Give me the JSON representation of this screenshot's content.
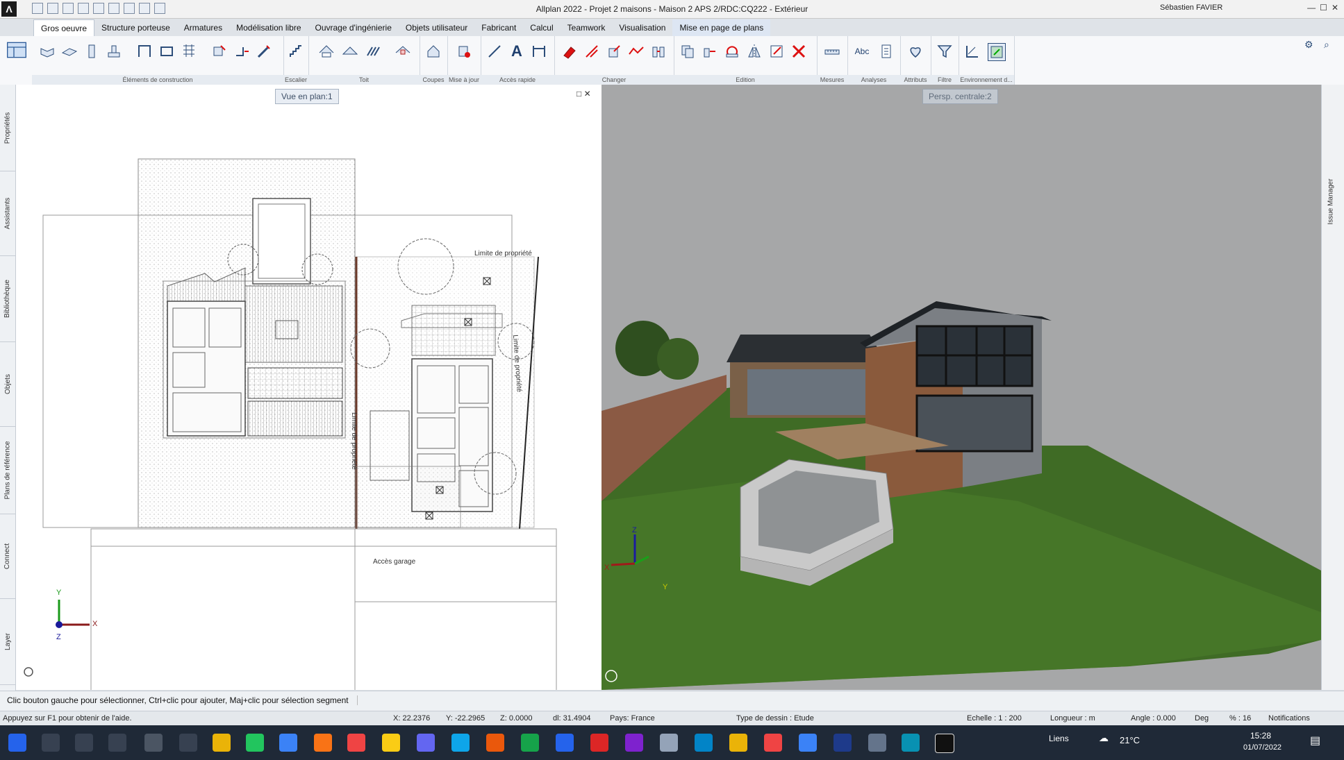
{
  "titlebar": {
    "logo": "Λ",
    "title": "Allplan 2022 - Projet 2 maisons - Maison 2 APS 2/RDC:CQ222 - Extérieur",
    "user": "Sébastien FAVIER",
    "controls": [
      "—",
      "☐",
      "✕"
    ]
  },
  "ribbon": {
    "tabs": [
      "Gros oeuvre",
      "Structure porteuse",
      "Armatures",
      "Modélisation libre",
      "Ouvrage d'ingénierie",
      "Objets utilisateur",
      "Fabricant",
      "Calcul",
      "Teamwork",
      "Visualisation",
      "Mise en page de plans"
    ],
    "groups": [
      "Éléments de construction",
      "Escalier",
      "Toit",
      "Coupes",
      "Mise à jour",
      "Accès rapide",
      "Changer",
      "Edition",
      "Mesures",
      "Analyses",
      "Attributs",
      "Filtre",
      "Environnement d..."
    ],
    "text_icon": "A",
    "abc_icon": "Abc"
  },
  "side_tabs": [
    "Propriétés",
    "Assistants",
    "Bibliothèque",
    "Objets",
    "Plans de référence",
    "Connect",
    "Layer"
  ],
  "plan_view": {
    "label": "Vue en plan:1",
    "controls": "□ ✕",
    "annotations": {
      "property_limit_top": "Limite de propriété",
      "property_limit_right": "Limite de propriété",
      "property_limit_middle": "Limite de propriété",
      "garage_access": "Accès garage"
    },
    "axis_x": "X",
    "axis_y": "Y",
    "axis_z": "Z"
  },
  "view3d": {
    "label": "Persp. centrale:2",
    "axis_x": "X",
    "axis_y": "Y",
    "axis_z": "Z"
  },
  "right_panel": {
    "issue_manager": "Issue Manager"
  },
  "prompt": "Clic bouton gauche pour sélectionner, Ctrl+clic pour ajouter, Maj+clic pour sélection segment",
  "status": {
    "help": "Appuyez sur F1 pour obtenir de l'aide.",
    "x": "X:  22.2376",
    "y": "Y:  -22.2965",
    "z": "Z:  0.0000",
    "dl": "dl:  31.4904",
    "country": "Pays:  France",
    "drawing_type": "Type de dessin :  Etude",
    "scale": "Echelle :  1 : 200",
    "length": "Longueur :  m",
    "angle": "Angle :  0.000",
    "deg": "Deg",
    "percent": "% :  16",
    "notifications": "Notifications"
  },
  "taskbar": {
    "links": "Liens",
    "temperature": "21°C",
    "time": "15:28",
    "date": "01/07/2022"
  }
}
